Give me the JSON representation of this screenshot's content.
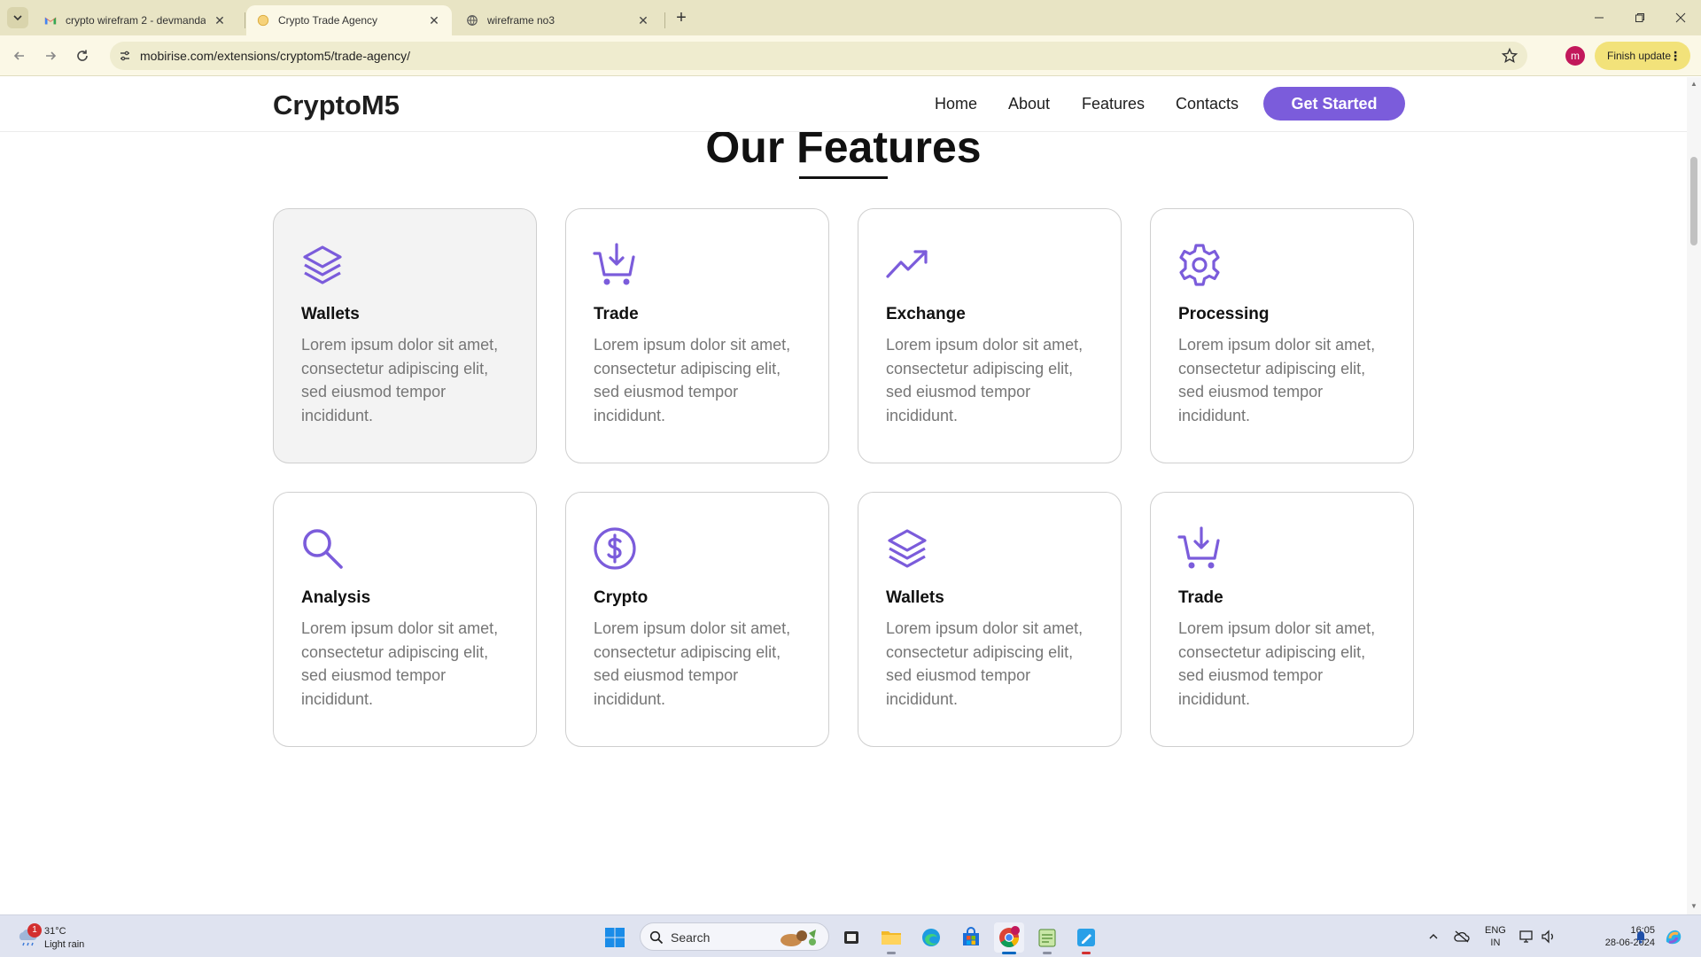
{
  "browser": {
    "tabs": [
      {
        "title": "crypto wirefram 2 - devmandan",
        "favicon": "gmail-icon",
        "active": false
      },
      {
        "title": "Crypto Trade Agency",
        "favicon": "site-favicon",
        "active": true
      },
      {
        "title": "wireframe no3",
        "favicon": "globe-icon",
        "active": false
      }
    ],
    "url": "mobirise.com/extensions/cryptom5/trade-agency/",
    "profile_initial": "m",
    "update_label": "Finish update"
  },
  "site": {
    "brand": "CryptoM5",
    "nav": [
      "Home",
      "About",
      "Features",
      "Contacts"
    ],
    "cta": "Get Started",
    "accent": "#7b5cdb"
  },
  "features": {
    "title": "Our Features",
    "cards": [
      {
        "title": "Wallets",
        "icon": "layers-icon",
        "desc": "Lorem ipsum dolor sit amet, consectetur adipiscing elit, sed eiusmod tempor incididunt."
      },
      {
        "title": "Trade",
        "icon": "cart-download-icon",
        "desc": "Lorem ipsum dolor sit amet, consectetur adipiscing elit, sed eiusmod tempor incididunt."
      },
      {
        "title": "Exchange",
        "icon": "trending-up-icon",
        "desc": "Lorem ipsum dolor sit amet, consectetur adipiscing elit, sed eiusmod tempor incididunt."
      },
      {
        "title": "Processing",
        "icon": "gear-icon",
        "desc": "Lorem ipsum dolor sit amet, consectetur adipiscing elit, sed eiusmod tempor incididunt."
      },
      {
        "title": "Analysis",
        "icon": "search-icon",
        "desc": "Lorem ipsum dolor sit amet, consectetur adipiscing elit, sed eiusmod tempor incididunt."
      },
      {
        "title": "Crypto",
        "icon": "dollar-circle-icon",
        "desc": "Lorem ipsum dolor sit amet, consectetur adipiscing elit, sed eiusmod tempor incididunt."
      },
      {
        "title": "Wallets",
        "icon": "layers-icon",
        "desc": "Lorem ipsum dolor sit amet, consectetur adipiscing elit, sed eiusmod tempor incididunt."
      },
      {
        "title": "Trade",
        "icon": "cart-download-icon",
        "desc": "Lorem ipsum dolor sit amet, consectetur adipiscing elit, sed eiusmod tempor incididunt."
      }
    ]
  },
  "taskbar": {
    "weather_badge": "1",
    "temperature": "31°C",
    "condition": "Light rain",
    "search_label": "Search",
    "lang_line1": "ENG",
    "lang_line2": "IN",
    "time": "16:05",
    "date": "28-06-2024"
  }
}
